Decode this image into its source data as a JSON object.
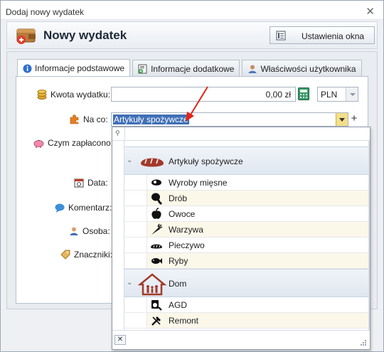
{
  "window": {
    "title": "Dodaj nowy wydatek",
    "close_glyph": "✕"
  },
  "header": {
    "title": "Nowy wydatek",
    "settings_button": "Ustawienia okna"
  },
  "tabs": [
    {
      "label": "Informacje podstawowe",
      "icon": "info-icon"
    },
    {
      "label": "Informacje dodatkowe",
      "icon": "form-add-icon"
    },
    {
      "label": "Właściwości użytkownika",
      "icon": "user-icon"
    }
  ],
  "form": {
    "amount_label": "Kwota wydatku:",
    "amount_value": "0,00 zł",
    "currency_value": "PLN",
    "category_label": "Na co:",
    "category_value": "Artykuły spożywcze",
    "payment_label": "Czym zapłacono:",
    "date_label": "Data:",
    "comment_label": "Komentarz:",
    "person_label": "Osoba:",
    "tags_label": "Znaczniki:",
    "plus_glyph": "+"
  },
  "dropdown": {
    "pin_glyph": "⚲",
    "footer_close_glyph": "✕",
    "groups": [
      {
        "label": "Artykuły spożywcze",
        "icon": "bread-icon",
        "children": [
          {
            "label": "Wyroby mięsne",
            "icon": "meat-icon"
          },
          {
            "label": "Drób",
            "icon": "drumstick-icon"
          },
          {
            "label": "Owoce",
            "icon": "apple-icon"
          },
          {
            "label": "Warzywa",
            "icon": "carrot-icon"
          },
          {
            "label": "Pieczywo",
            "icon": "bread-loaf-icon"
          },
          {
            "label": "Ryby",
            "icon": "fish-icon"
          }
        ]
      },
      {
        "label": "Dom",
        "icon": "house-family-icon",
        "children": [
          {
            "label": "AGD",
            "icon": "appliance-icon"
          },
          {
            "label": "Remont",
            "icon": "tools-icon"
          }
        ]
      }
    ]
  },
  "colors": {
    "selection": "#3f6fb6",
    "annotation_arrow": "#e0241b",
    "group_icon": "#a23a2a"
  }
}
